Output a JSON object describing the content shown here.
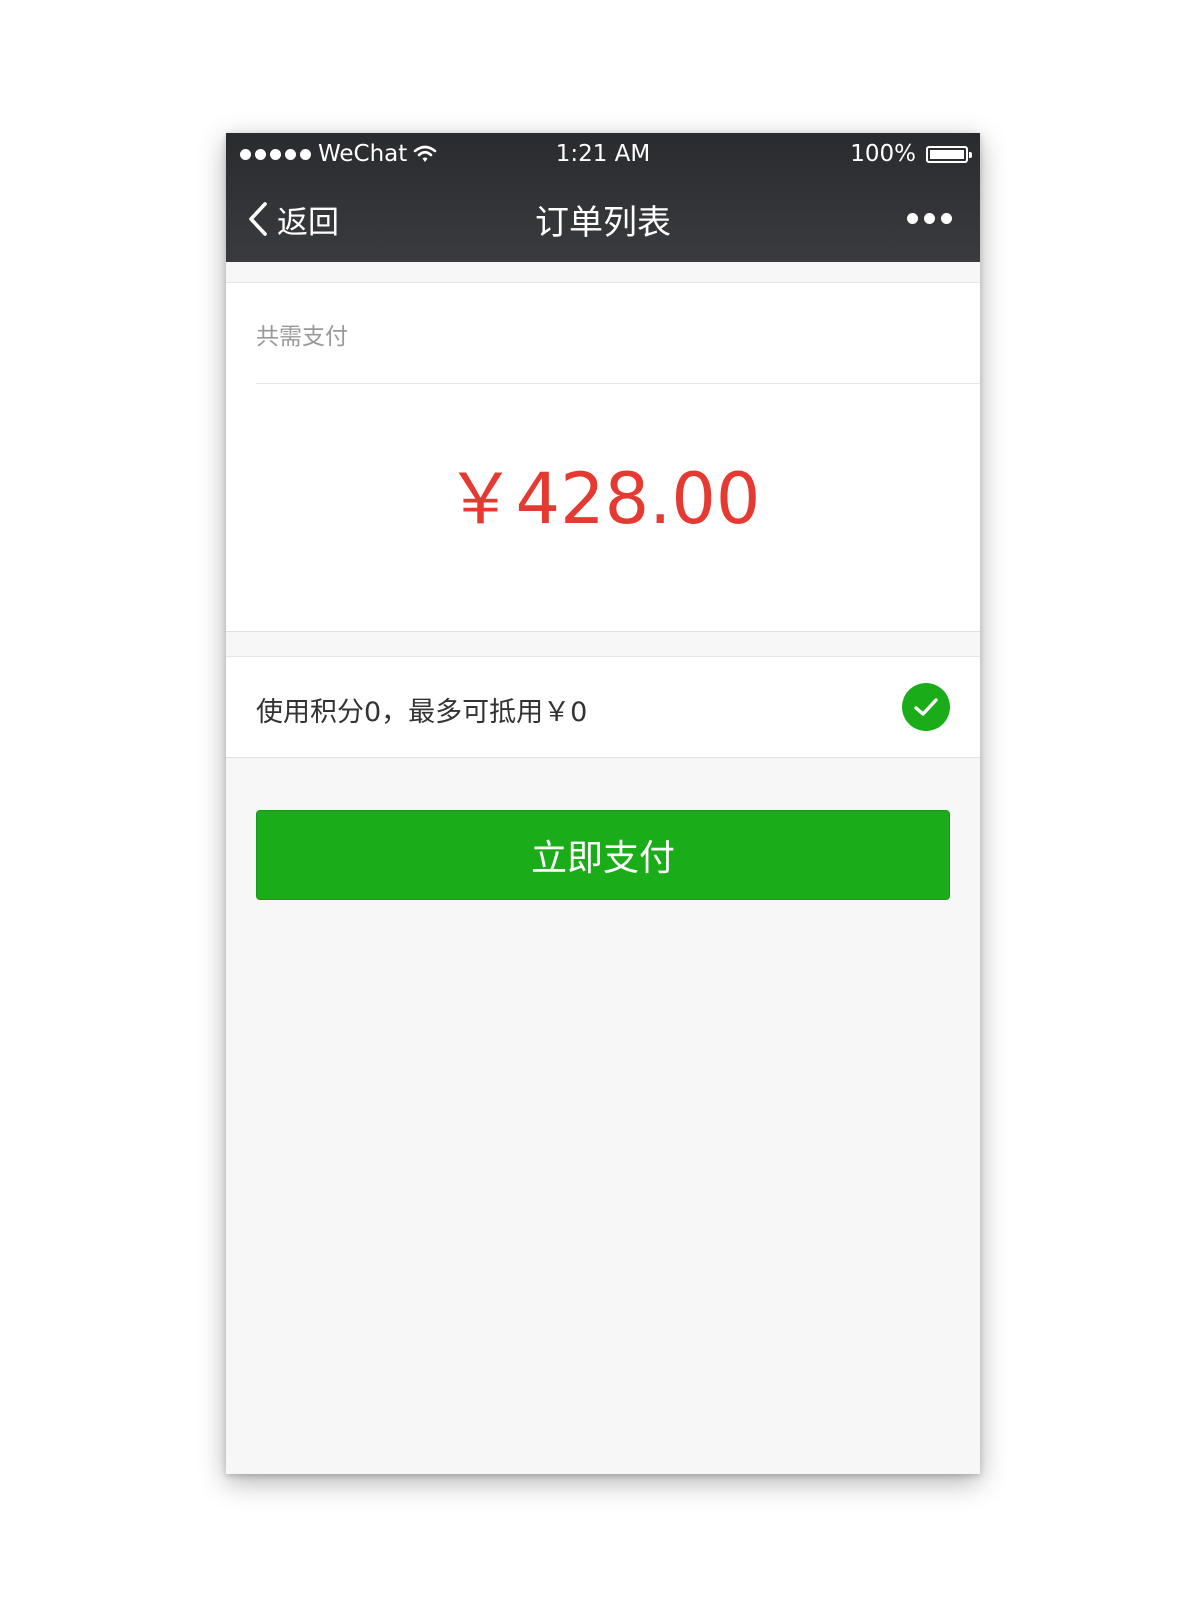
{
  "status_bar": {
    "carrier": "WeChat",
    "time": "1:21 AM",
    "battery": "100%",
    "battery_level": 1.0
  },
  "nav": {
    "back_label": "返回",
    "title": "订单列表"
  },
  "payment": {
    "total_label": "共需支付",
    "amount": "￥428.00"
  },
  "points": {
    "text": "使用积分0，最多可抵用￥0",
    "checked": true
  },
  "actions": {
    "pay_button": "立即支付"
  },
  "colors": {
    "nav_bg": "#2a2b2e",
    "amount_red": "#e53a32",
    "wechat_green": "#1aad19",
    "page_bg": "#f7f7f7"
  },
  "icons": [
    "signal-dots-icon",
    "wifi-icon",
    "battery-icon",
    "chevron-left-icon",
    "more-dots-icon",
    "check-circle-icon"
  ]
}
